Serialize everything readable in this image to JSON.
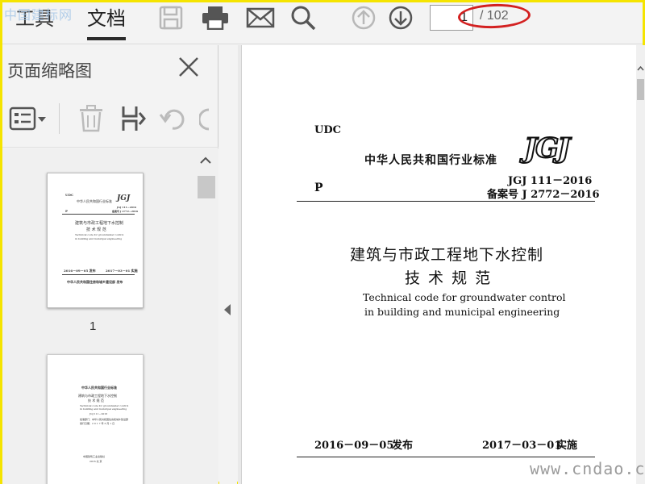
{
  "watermark_top": "中国建标网",
  "toolbar": {
    "tab_tools": "工具",
    "tab_document": "文档",
    "icons": [
      "save-icon",
      "print-icon",
      "mail-icon",
      "search-icon",
      "page-up-icon",
      "page-down-icon"
    ],
    "current_page": "1",
    "page_total": "/ 102"
  },
  "sidebar": {
    "title": "页面缩略图",
    "tool_icons": [
      "thumbnail-options-icon",
      "delete-page-icon",
      "extract-page-icon",
      "rotate-left-icon",
      "rotate-right-icon"
    ],
    "thumbnails": [
      {
        "page_label": "1",
        "lines": {
          "udc": "UDC",
          "org": "中华人民共和国行业标准",
          "logo": "JGJ",
          "p": "P",
          "code": "JGJ 111－2016",
          "record": "备案号 J 2772－2016",
          "title1": "建筑与市政工程地下水控制",
          "title2": "技 术 规 范",
          "en1": "Technical code for groundwater control",
          "en2": "in building and municipal engineering",
          "issue": "2016－09－05 发布",
          "impl": "2017－03－01 实施",
          "publisher": "中华人民共和国住房和城乡建设部 发布"
        }
      },
      {
        "page_label": "",
        "lines": {
          "org": "中华人民共和国行业标准",
          "title1": "建筑与市政工程地下水控制",
          "title2": "技 术 规 范",
          "en1": "Technical code for groundwater control",
          "en2": "in building and municipal engineering",
          "code": "JGJ 111－2016",
          "dept": "批准部门：中华人民共和国住房和城乡建设部",
          "date": "施行日期：2 0 1 7 年 3 月 1 日",
          "press": "中国建筑工业出版社",
          "city": "2016 北 京"
        }
      }
    ]
  },
  "document": {
    "udc": "UDC",
    "org": "中华人民共和国行业标准",
    "logo": "JGJ",
    "p": "P",
    "code": "JGJ 111－2016",
    "record": "备案号 J 2772－2016",
    "title_cn_1": "建筑与市政工程地下水控制",
    "title_cn_2": "技 术 规 范",
    "title_en_1": "Technical code for groundwater control",
    "title_en_2": "in building and municipal engineering",
    "issue_date": "2016－09－05",
    "issue_label": "发布",
    "impl_date": "2017－03－01",
    "impl_label": "实施"
  },
  "watermark_bottom": "www.cndao.com",
  "colors": {
    "annotation_red": "#d32020",
    "border_yellow": "#f5e400"
  }
}
